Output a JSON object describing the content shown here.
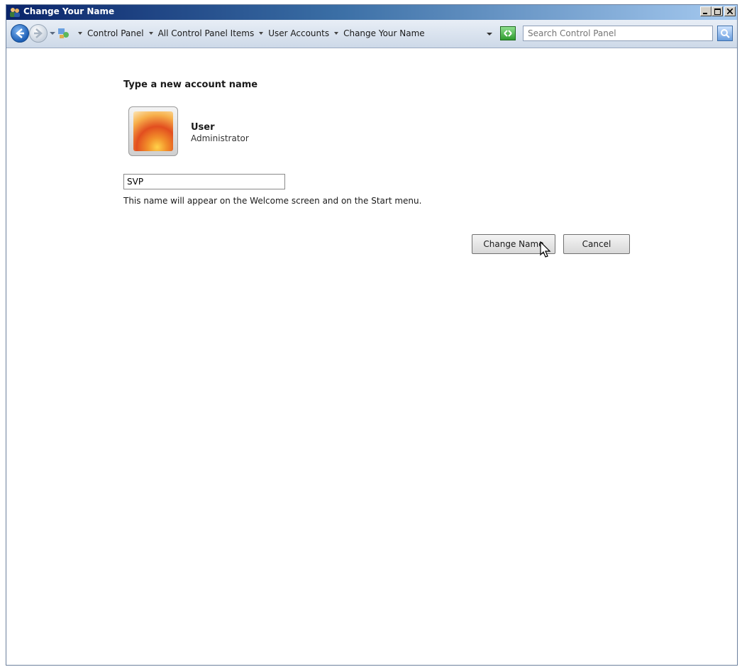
{
  "window": {
    "title": "Change Your Name",
    "controls": [
      "minimize",
      "maximize",
      "close"
    ]
  },
  "addressbar": {
    "breadcrumbs": [
      "Control Panel",
      "All Control Panel Items",
      "User Accounts",
      "Change Your Name"
    ],
    "search_placeholder": "Search Control Panel",
    "icons": [
      "back-icon",
      "forward-icon",
      "control-panel-icon",
      "refresh-icon",
      "search-icon"
    ]
  },
  "main": {
    "heading": "Type a new account name",
    "user": {
      "name": "User",
      "role": "Administrator"
    },
    "name_input_value": "SVP",
    "hint": "This name will appear on the Welcome screen and on the Start menu.",
    "buttons": {
      "change_name": "Change Name",
      "cancel": "Cancel"
    }
  },
  "colors": {
    "titlebar_start": "#0a246a",
    "titlebar_end": "#a6caf0"
  }
}
